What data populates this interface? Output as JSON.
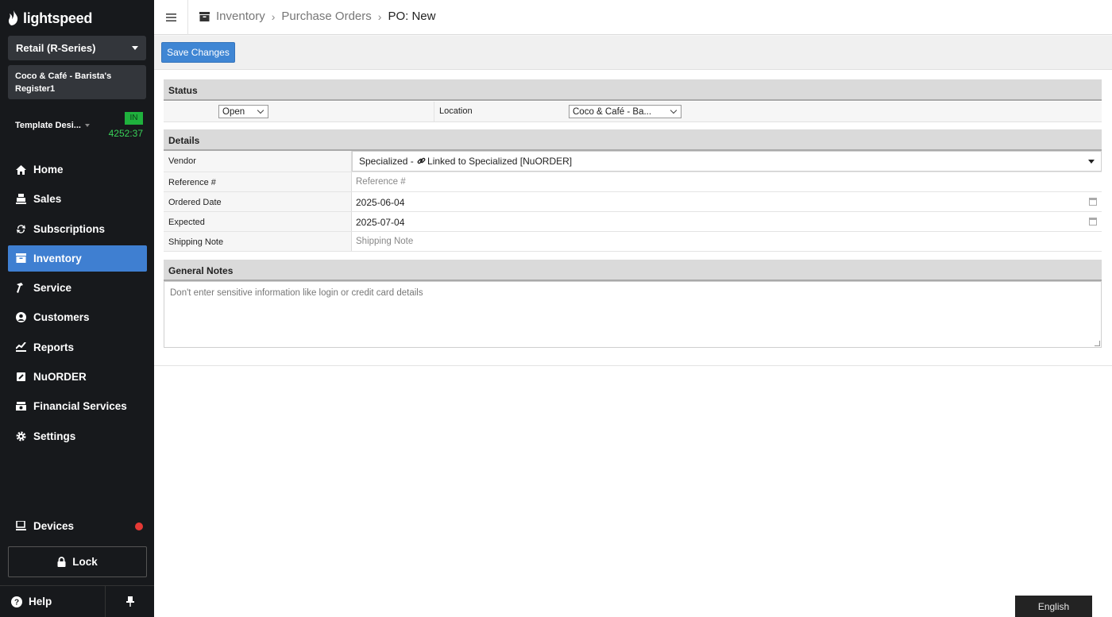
{
  "brand": {
    "name": "lightspeed"
  },
  "sidebar": {
    "product": "Retail (R-Series)",
    "register_line1": "Coco & Café - Barista's",
    "register_line2": "Register1",
    "template": "Template Desi...",
    "clock_badge": "IN",
    "timer": "4252:37",
    "items": [
      {
        "label": "Home",
        "icon": "home-icon"
      },
      {
        "label": "Sales",
        "icon": "register-icon"
      },
      {
        "label": "Subscriptions",
        "icon": "refresh-icon"
      },
      {
        "label": "Inventory",
        "icon": "inventory-icon"
      },
      {
        "label": "Service",
        "icon": "hammer-icon"
      },
      {
        "label": "Customers",
        "icon": "user-icon"
      },
      {
        "label": "Reports",
        "icon": "chart-icon"
      },
      {
        "label": "NuORDER",
        "icon": "nuorder-icon"
      },
      {
        "label": "Financial Services",
        "icon": "cash-icon"
      },
      {
        "label": "Settings",
        "icon": "gear-icon"
      }
    ],
    "devices": "Devices",
    "lock": "Lock",
    "help": "Help"
  },
  "breadcrumb": {
    "c1": "Inventory",
    "c2": "Purchase Orders",
    "c3": "PO: New"
  },
  "toolbar": {
    "save_label": "Save Changes"
  },
  "status_section": {
    "title": "Status",
    "status_value": "Open",
    "location_label": "Location",
    "location_value": "Coco & Café - Ba..."
  },
  "details": {
    "title": "Details",
    "vendor_label": "Vendor",
    "vendor_value_a": "Specialized - ",
    "vendor_value_b": "Linked to Specialized [NuORDER]",
    "reference_label": "Reference #",
    "reference_placeholder": "Reference #",
    "ordered_label": "Ordered Date",
    "ordered_value": "2025-06-04",
    "expected_label": "Expected",
    "expected_value": "2025-07-04",
    "shipping_label": "Shipping Note",
    "shipping_placeholder": "Shipping Note"
  },
  "notes": {
    "title": "General Notes",
    "placeholder": "Don't enter sensitive information like login or credit card details"
  },
  "language": "English",
  "colors": {
    "sidebar_bg": "#17191c",
    "accent": "#3f7fd1",
    "clock_green": "#1fb13d",
    "alert_red": "#e53935"
  }
}
